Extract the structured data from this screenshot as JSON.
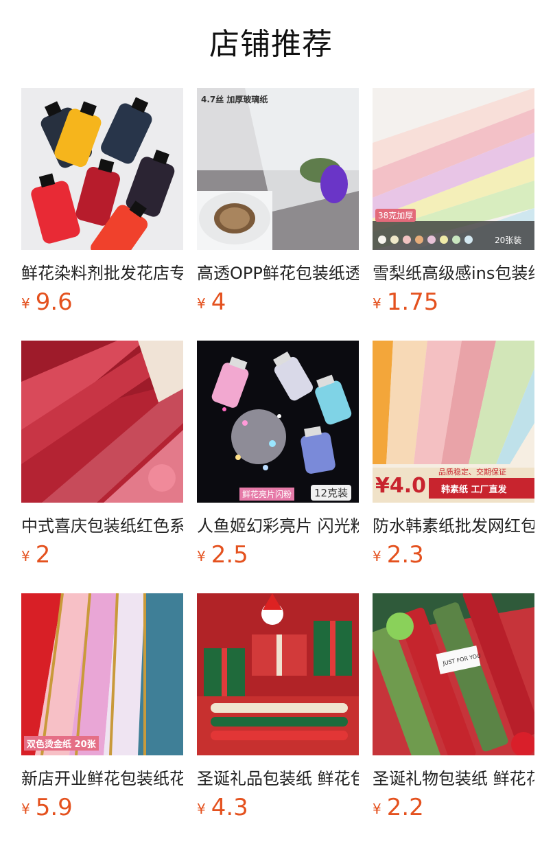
{
  "page": {
    "title": "店铺推荐",
    "currency_symbol": "¥",
    "price_color": "#e4511e"
  },
  "products": [
    {
      "name": "鲜花染料剂批发花店专用",
      "price": "9.6",
      "image_icon": "dye-bottles-image",
      "image_texts": []
    },
    {
      "name": "高透OPP鲜花包装纸透明",
      "price": "4",
      "image_icon": "cellophane-roll-image",
      "image_texts": [
        "4.7丝 加厚玻璃纸"
      ]
    },
    {
      "name": "雪梨纸高级感ins包装纸",
      "price": "1.75",
      "image_icon": "tissue-paper-image",
      "image_texts": [
        "38克加厚",
        "20张装"
      ]
    },
    {
      "name": "中式喜庆包装纸红色系列",
      "price": "2",
      "image_icon": "red-wrapping-paper-image",
      "image_texts": []
    },
    {
      "name": "人鱼姬幻彩亮片 闪光粉",
      "price": "2.5",
      "image_icon": "glitter-bottles-image",
      "image_texts": [
        "鲜花亮片闪粉",
        "12克装"
      ]
    },
    {
      "name": "防水韩素纸批发网红包装",
      "price": "2.3",
      "image_icon": "korean-paper-image",
      "image_texts": [
        "¥4.0",
        "品质稳定、交期保证",
        "韩素纸 工厂直发"
      ]
    },
    {
      "name": "新店开业鲜花包装纸花束",
      "price": "5.9",
      "image_icon": "gold-edge-paper-image",
      "image_texts": [
        "双色烫金纸 20张"
      ]
    },
    {
      "name": "圣诞礼品包装纸 鲜花包装",
      "price": "4.3",
      "image_icon": "christmas-gifts-image",
      "image_texts": []
    },
    {
      "name": "圣诞礼物包装纸 鲜花花束",
      "price": "2.2",
      "image_icon": "christmas-paper-rolls-image",
      "image_texts": [
        "JUST FOR YOU"
      ]
    }
  ]
}
